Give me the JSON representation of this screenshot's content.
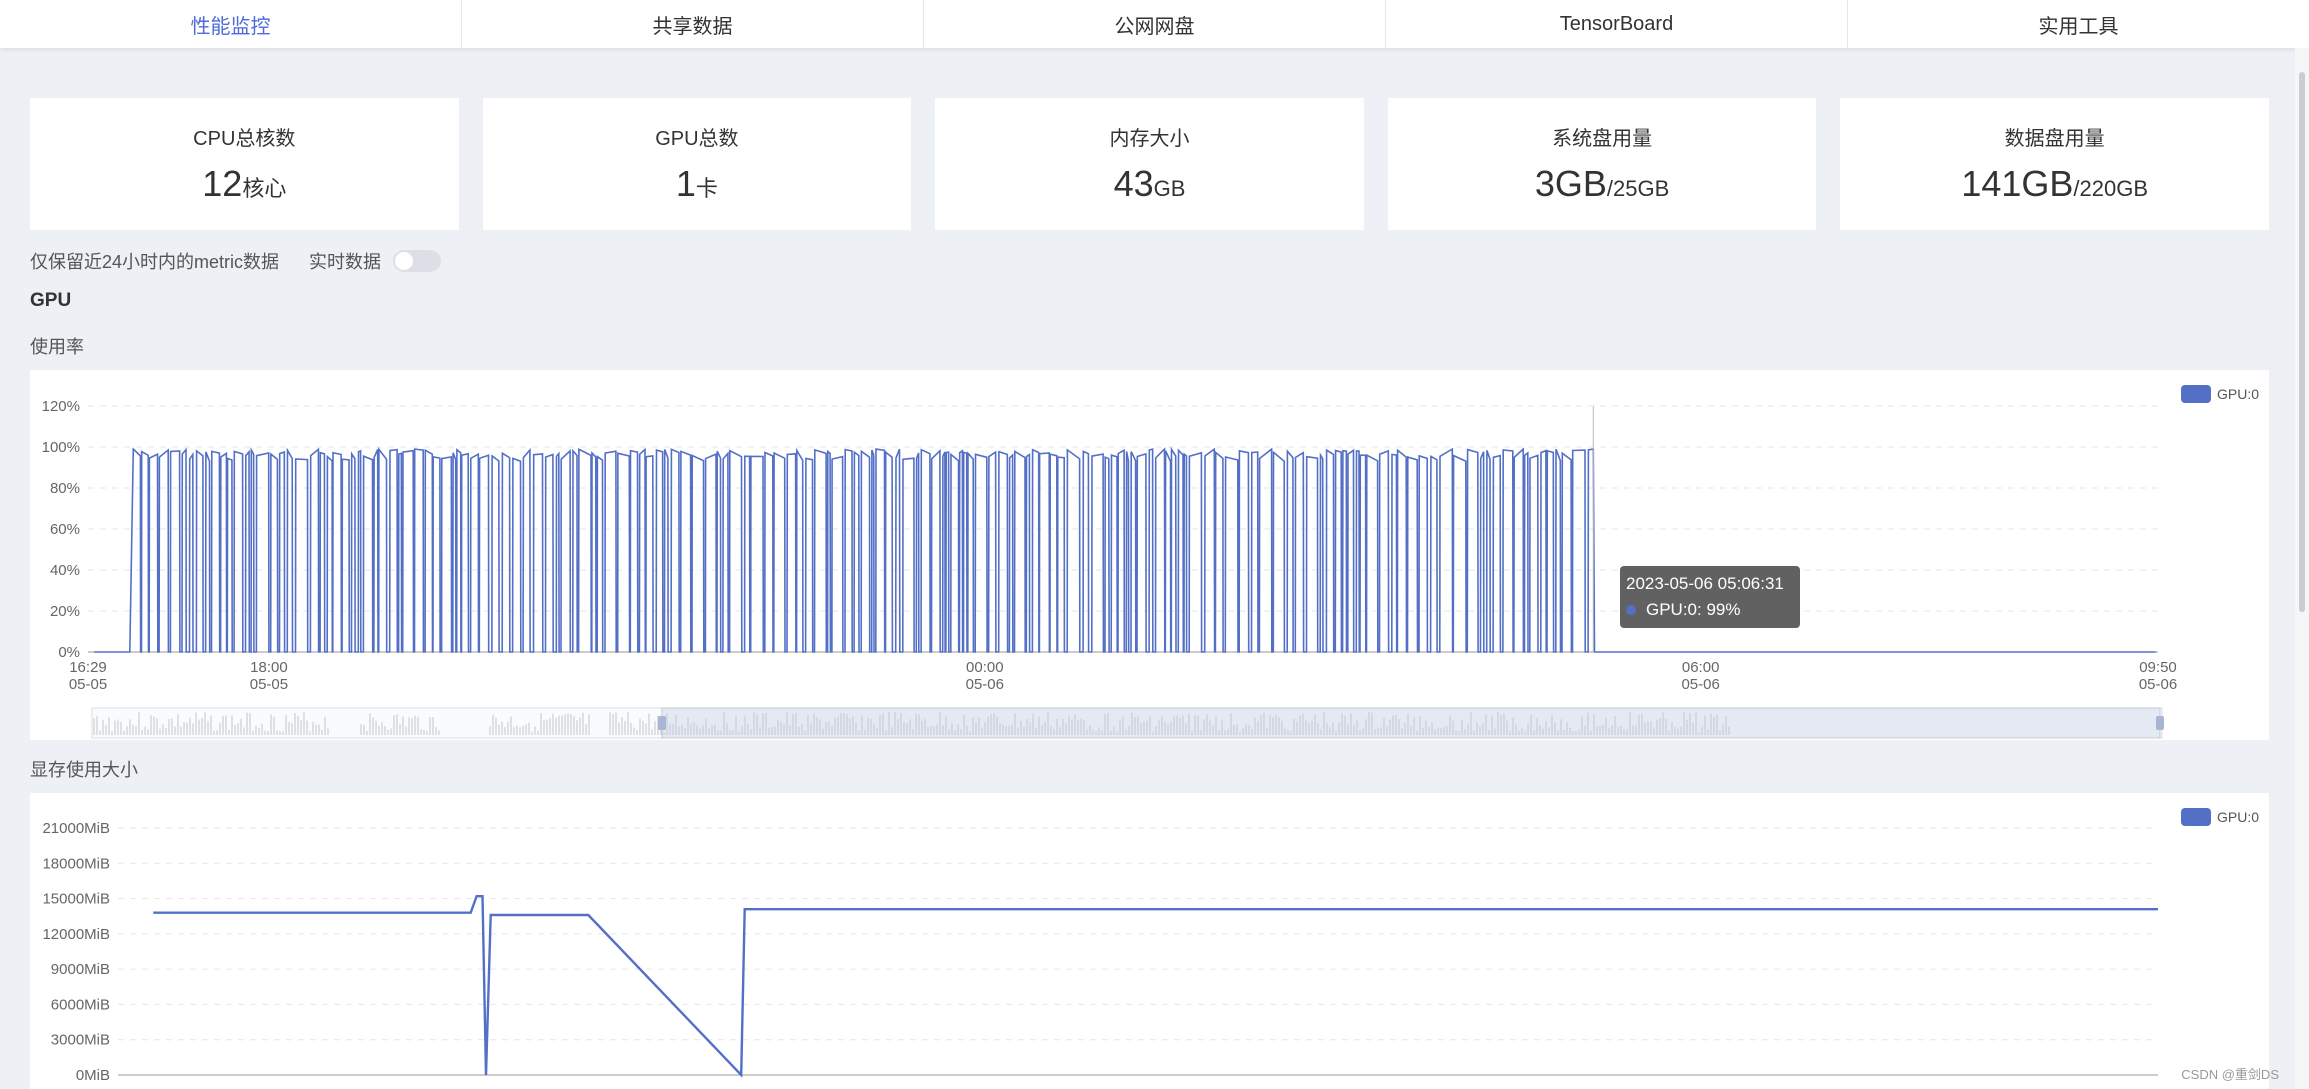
{
  "tabs": [
    {
      "label": "性能监控",
      "active": true
    },
    {
      "label": "共享数据",
      "active": false
    },
    {
      "label": "公网网盘",
      "active": false
    },
    {
      "label": "TensorBoard",
      "active": false
    },
    {
      "label": "实用工具",
      "active": false
    }
  ],
  "stats": [
    {
      "title": "CPU总核数",
      "value": "12",
      "unit": "核心"
    },
    {
      "title": "GPU总数",
      "value": "1",
      "unit": "卡"
    },
    {
      "title": "内存大小",
      "value": "43",
      "unit": "GB"
    },
    {
      "title": "系统盘用量",
      "value": "3GB",
      "unit": "/25GB"
    },
    {
      "title": "数据盘用量",
      "value": "141GB",
      "unit": "/220GB"
    }
  ],
  "options": {
    "retention_note": "仅保留近24小时内的metric数据",
    "realtime_label": "实时数据",
    "realtime_on": false
  },
  "gpu_section": {
    "title": "GPU",
    "usage_label": "使用率",
    "memory_label": "显存使用大小"
  },
  "tooltip": {
    "time": "2023-05-06 05:06:31",
    "series": "GPU:0: 99%"
  },
  "colors": {
    "accent": "#4e6bd9",
    "series": "#5470c6"
  },
  "watermark": "CSDN @重剑DS",
  "chart_data": [
    {
      "type": "line",
      "title": "使用率",
      "series": [
        {
          "name": "GPU:0"
        }
      ],
      "x_ticks": [
        {
          "time": "16:29",
          "date": "05-05"
        },
        {
          "time": "18:00",
          "date": "05-05"
        },
        {
          "time": "00:00",
          "date": "05-06"
        },
        {
          "time": "06:00",
          "date": "05-06"
        },
        {
          "time": "09:50",
          "date": "05-06"
        }
      ],
      "xlim": [
        "2023-05-05 16:29",
        "2023-05-06 09:50"
      ],
      "ylim": [
        0,
        120
      ],
      "y_ticks": [
        "0%",
        "20%",
        "40%",
        "60%",
        "80%",
        "100%",
        "120%"
      ],
      "pattern": "Rapid oscillation between 0% and ~99% from about 16:50 on 05-05 until 05:06 on 05-06, then flat at 0% until 09:50",
      "active_end": "2023-05-06 05:06",
      "active_value": 99,
      "grid": true,
      "legend": "top-right",
      "has_zoom_slider": true
    },
    {
      "type": "line",
      "title": "显存使用大小",
      "series": [
        {
          "name": "GPU:0"
        }
      ],
      "ylim": [
        0,
        21000
      ],
      "y_ticks": [
        "0MiB",
        "3000MiB",
        "6000MiB",
        "9000MiB",
        "12000MiB",
        "15000MiB",
        "18000MiB",
        "21000MiB"
      ],
      "points_hours_since_start": [
        [
          0.3,
          13800
        ],
        [
          3.0,
          13800
        ],
        [
          3.05,
          15200
        ],
        [
          3.1,
          15200
        ],
        [
          3.13,
          0
        ],
        [
          3.17,
          13600
        ],
        [
          4.0,
          13600
        ],
        [
          5.3,
          0
        ],
        [
          5.33,
          14100
        ],
        [
          17.35,
          14100
        ]
      ],
      "grid": true,
      "legend": "top-right"
    }
  ]
}
